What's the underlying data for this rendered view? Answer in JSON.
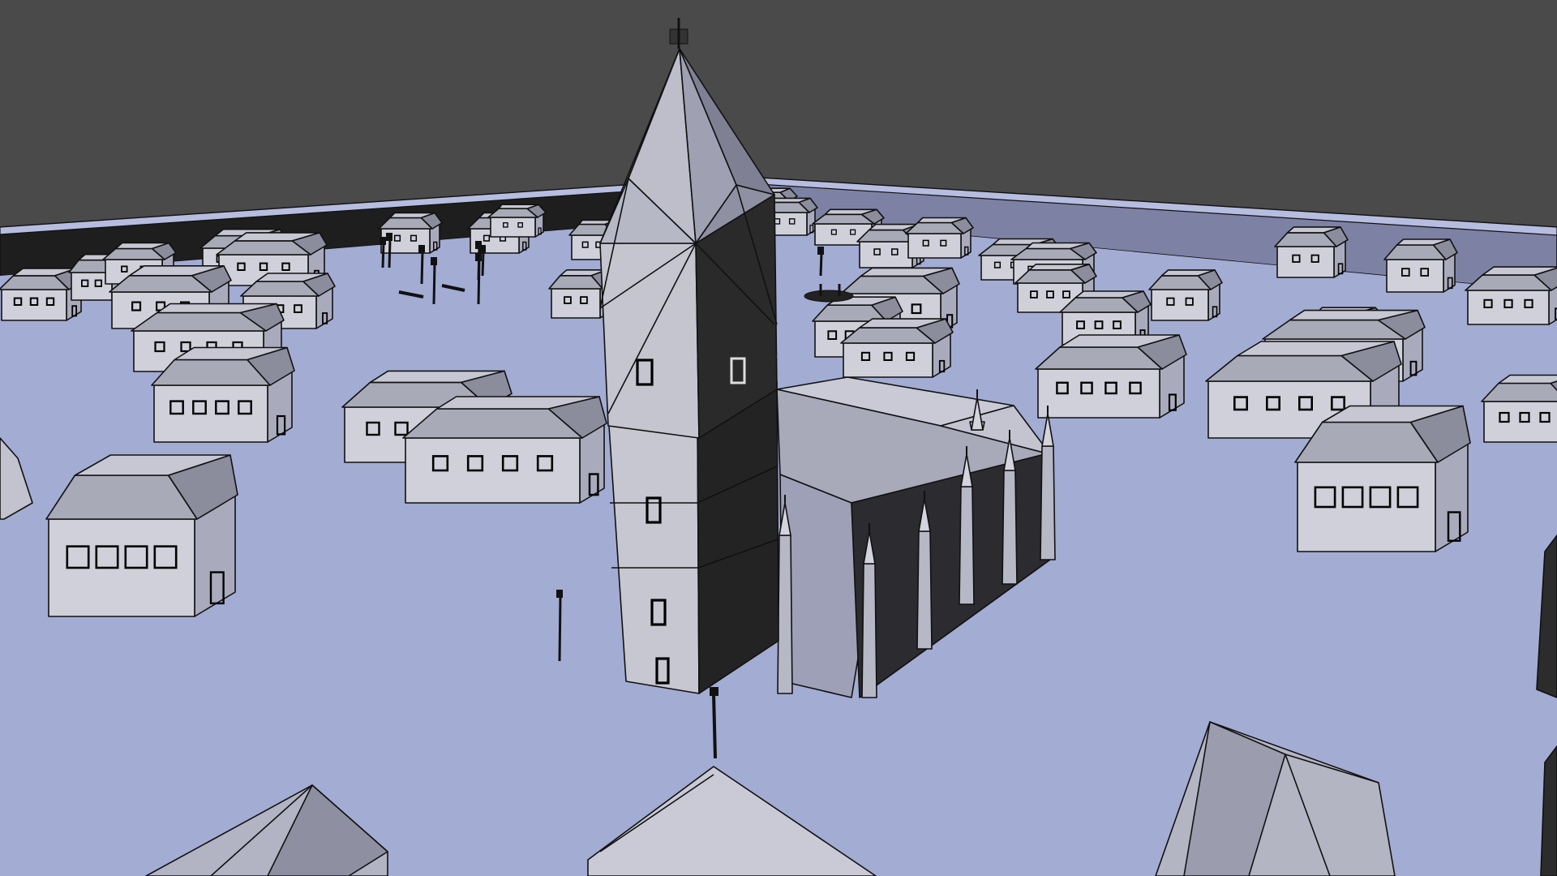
{
  "viewport": {
    "title": "",
    "colors": {
      "background": "#4a4a4a",
      "ground": "#a3acd3",
      "wall_shadow": "#1e1e1e",
      "wall_lit": "#7d82a5",
      "wall_top": "#b6bde0",
      "roof_light": "#c6c7d2",
      "roof_mid": "#a9aab8",
      "roof_dark": "#8b8c9c",
      "facade": "#cfd0d9",
      "facade_side": "#a9abbd",
      "dark_face": "#262626",
      "edge": "#111111"
    }
  },
  "scene": {
    "objects": [
      "church-tower",
      "church-nave",
      "houses",
      "street-lamps",
      "benches",
      "boundary-wall",
      "ground-plane"
    ]
  }
}
